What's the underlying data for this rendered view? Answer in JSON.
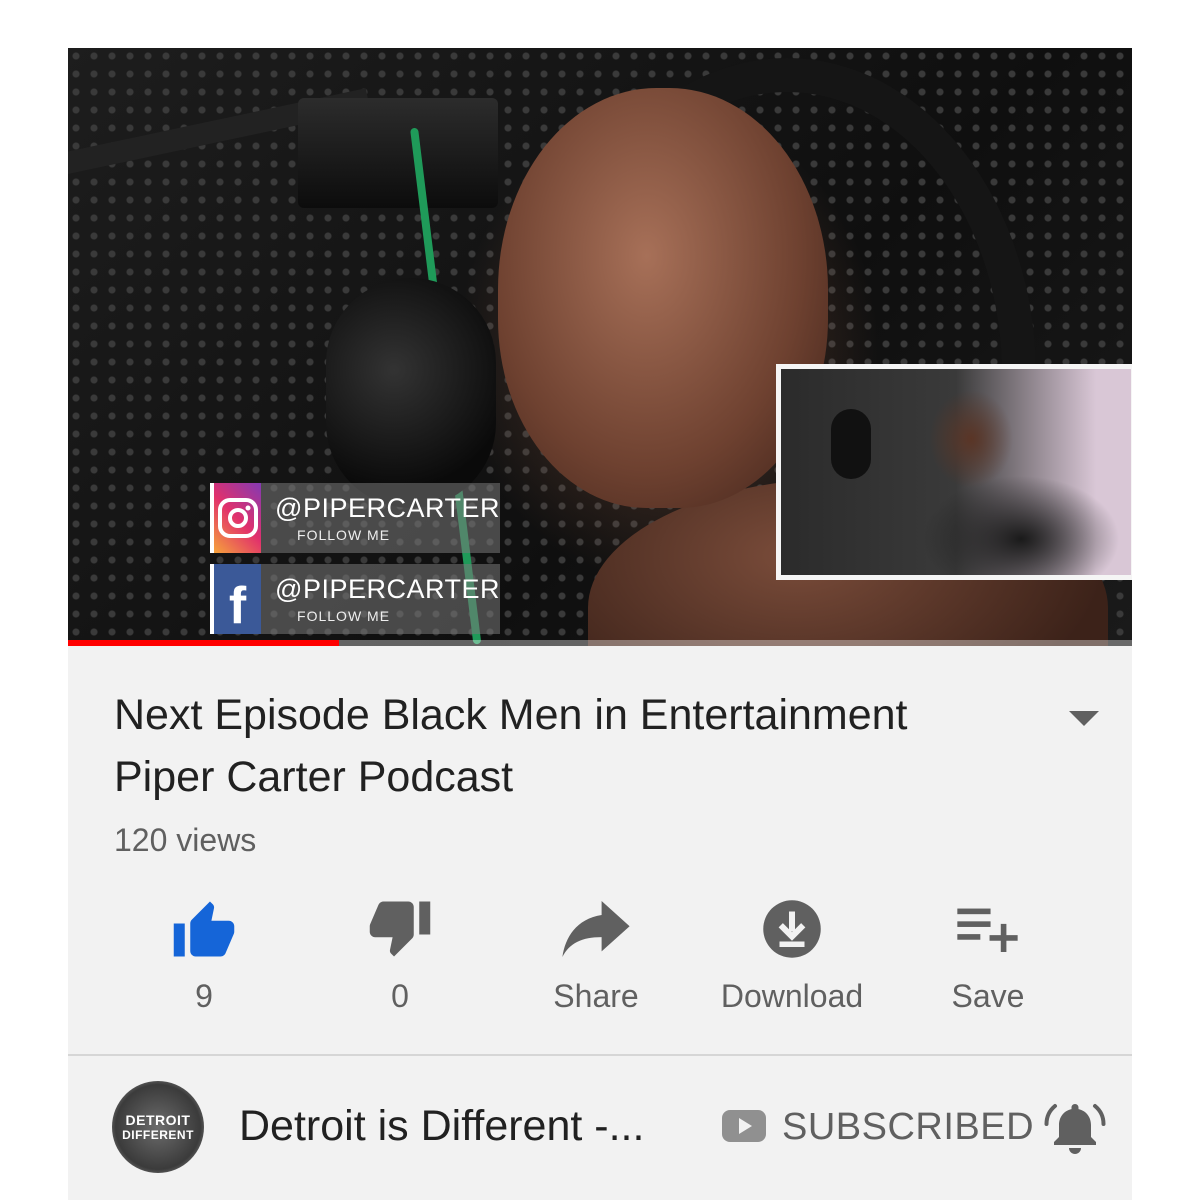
{
  "video": {
    "overlay": {
      "instagram": {
        "handle": "@PIPERCARTER",
        "follow": "FOLLOW ME"
      },
      "facebook": {
        "handle": "@PIPERCARTER",
        "follow": "FOLLOW ME",
        "letter": "f"
      }
    },
    "progress_fraction": 0.255,
    "progress_color": "#ff0000"
  },
  "title": {
    "line1": "Next Episode Black Men in Entertainment",
    "line2": "Piper Carter Podcast"
  },
  "views": "120 views",
  "actions": [
    {
      "name": "like",
      "icon": "thumbs-up-icon",
      "label": "9",
      "color": "#1565d8"
    },
    {
      "name": "dislike",
      "icon": "thumbs-down-icon",
      "label": "0",
      "color": "#606060"
    },
    {
      "name": "share",
      "icon": "share-arrow-icon",
      "label": "Share",
      "color": "#606060"
    },
    {
      "name": "download",
      "icon": "download-icon",
      "label": "Download",
      "color": "#606060"
    },
    {
      "name": "save",
      "icon": "playlist-add-icon",
      "label": "Save",
      "color": "#606060"
    }
  ],
  "channel": {
    "name": "Detroit is Different -...",
    "avatar_text_1": "DETROIT",
    "avatar_text_2": "DIFFERENT",
    "subscribe_label": "SUBSCRIBED"
  }
}
